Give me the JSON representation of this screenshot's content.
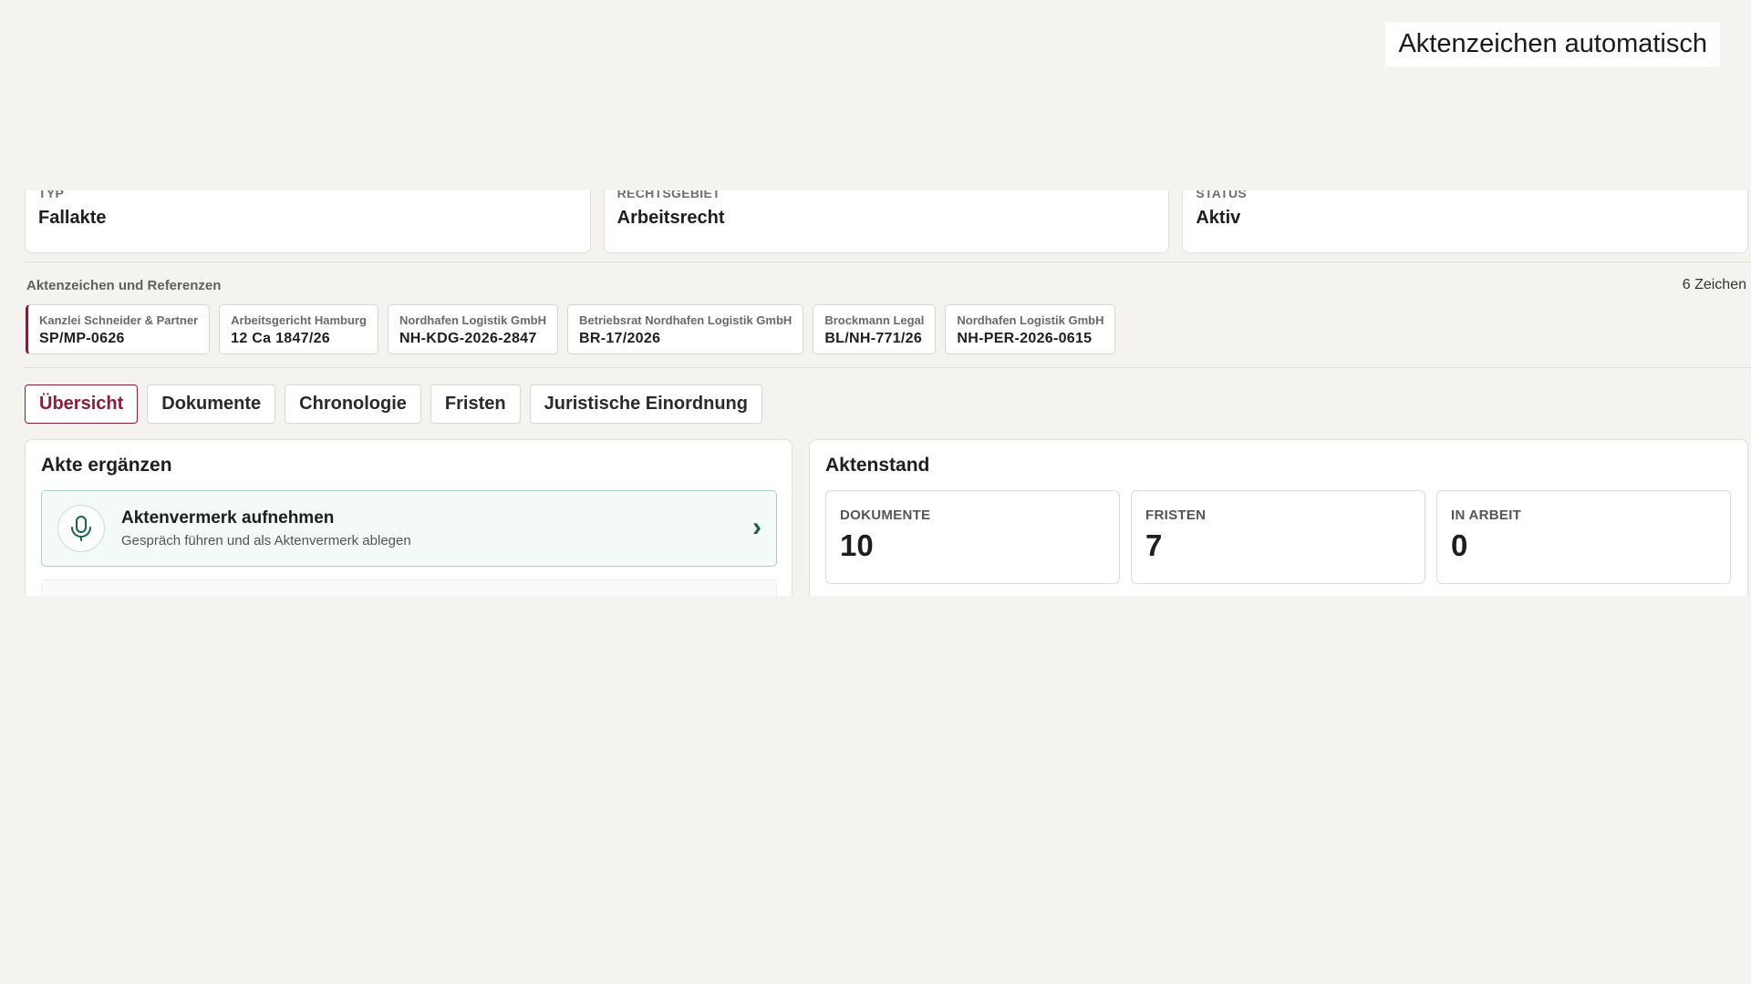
{
  "caption": "Aktenzeichen automatisch",
  "meta": [
    {
      "label": "Typ",
      "value": "Fallakte"
    },
    {
      "label": "Rechtsgebiet",
      "value": "Arbeitsrecht"
    },
    {
      "label": "Status",
      "value": "Aktiv"
    }
  ],
  "refs": {
    "title": "Aktenzeichen und Referenzen",
    "count": "6 Zeichen",
    "items": [
      {
        "org": "Kanzlei Schneider & Partner",
        "code": "SP/MP-0626"
      },
      {
        "org": "Arbeitsgericht Hamburg",
        "code": "12 Ca 1847/26"
      },
      {
        "org": "Nordhafen Logistik GmbH",
        "code": "NH-KDG-2026-2847"
      },
      {
        "org": "Betriebsrat Nordhafen Logistik GmbH",
        "code": "BR-17/2026"
      },
      {
        "org": "Brockmann Legal",
        "code": "BL/NH-771/26"
      },
      {
        "org": "Nordhafen Logistik GmbH",
        "code": "NH-PER-2026-0615"
      }
    ]
  },
  "tabs": [
    "Übersicht",
    "Dokumente",
    "Chronologie",
    "Fristen",
    "Juristische Einordnung"
  ],
  "left_panel": {
    "title": "Akte ergänzen",
    "action_title": "Aktenvermerk aufnehmen",
    "action_sub": "Gespräch führen und als Aktenvermerk ablegen",
    "action_icon": "microphone-icon",
    "chevron": "›"
  },
  "right_panel": {
    "title": "Aktenstand",
    "stats": [
      {
        "label": "Dokumente",
        "value": "10"
      },
      {
        "label": "Fristen",
        "value": "7"
      },
      {
        "label": "In Arbeit",
        "value": "0"
      }
    ]
  },
  "colors": {
    "accent": "#8a1c3c",
    "action_bg": "#f3faf8",
    "action_border": "#a9d3c7",
    "icon_green": "#1c5f4d",
    "page_bg": "#f4f3f0"
  }
}
